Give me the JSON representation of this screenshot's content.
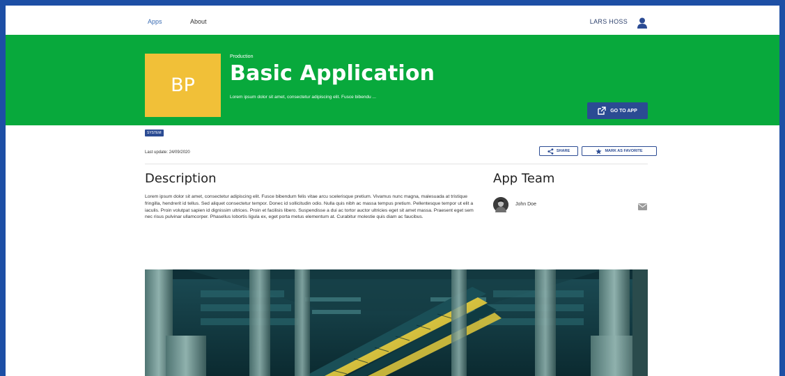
{
  "nav": {
    "apps_label": "Apps",
    "about_label": "About",
    "user_name": "LARS HOSS"
  },
  "app": {
    "logo_initials": "BP",
    "environment": "Production",
    "title": "Basic Application",
    "short_description": "Lorem ipsum dolor sit amet, consectetur adipiscing elit. Fusce bibendu ...",
    "goto_label": "GO TO APP",
    "badge": "SYSTEM",
    "last_update": "Last update: 24/09/2020",
    "share_label": "SHARE",
    "favorite_label": "MARK AS FAVORITE"
  },
  "description": {
    "heading": "Description",
    "body": "Lorem ipsum dolor sit amet, consectetur adipiscing elit. Fusce bibendum felis vitae arcu scelerisque pretium. Vivamus nunc magna, malesuada at tristique fringilla, hendrerit id tellus. Sed aliquet consectetur tempor. Donec id sollicitudin odio. Nulla quis nibh ac massa tempus pretium. Pellentesque tempor ut elit a iaculis. Proin volutpat sapien id dignissim ultrices. Proin et facilisis libero. Suspendisse a dui ac tortor auctor ultricies eget sit amet massa. Praesent eget sem nec risus pulvinar ullamcorper. Phasellus lobortis ligula ex, eget porta metus elementum at. Curabitur molestie quis diam ac faucibus."
  },
  "team": {
    "heading": "App Team",
    "members": [
      {
        "name": "John Doe"
      }
    ]
  },
  "colors": {
    "frame": "#1d4fa5",
    "hero_green": "#08a93c",
    "logo_yellow": "#f1c038",
    "primary_navy": "#2b4b93"
  },
  "icons": {
    "user": "user-icon",
    "external_link": "external-link-icon",
    "share": "share-icon",
    "star": "star-icon",
    "mail": "mail-icon"
  }
}
